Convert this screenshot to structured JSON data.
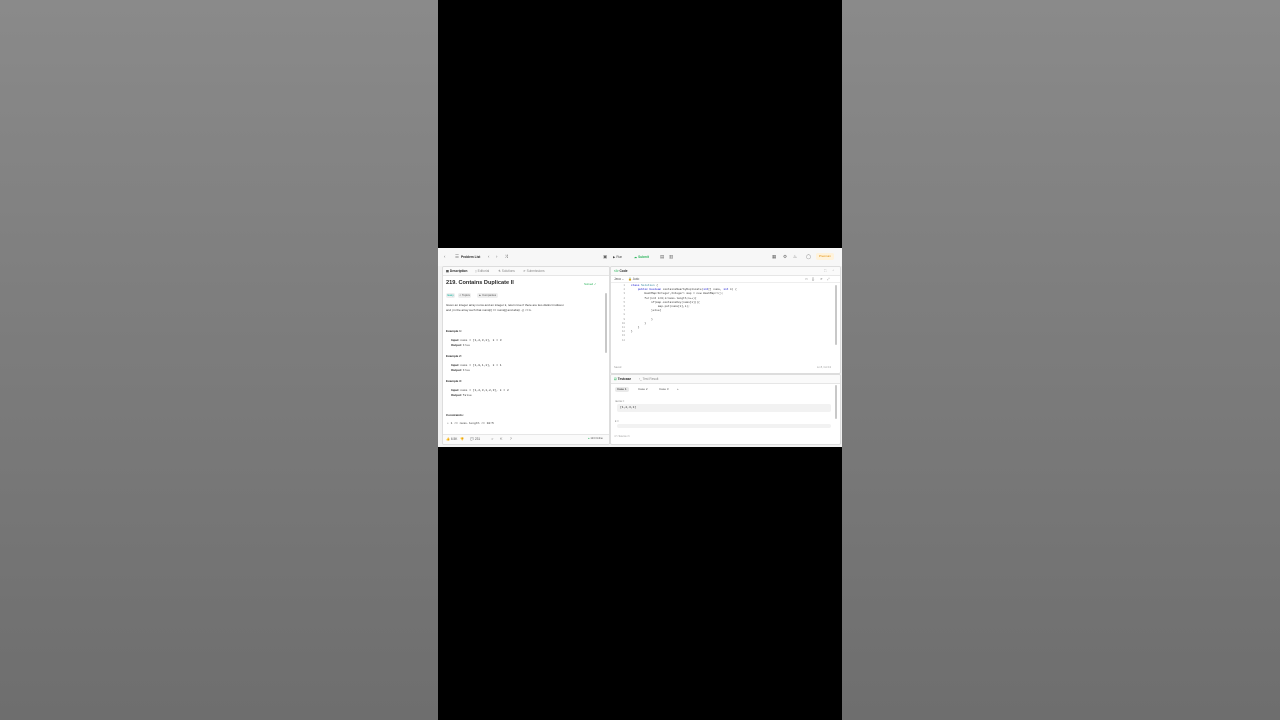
{
  "app": {
    "problem_list_label": "Problem List",
    "run_label": "Run",
    "submit_label": "Submit",
    "premium_label": "Premium"
  },
  "left": {
    "tabs": [
      "Description",
      "Editorial",
      "Solutions",
      "Submissions"
    ],
    "title": "219. Contains Duplicate II",
    "solved": "Solved",
    "chips": [
      "Easy",
      "Topics",
      "Companies"
    ],
    "desc_line1": "Given an integer array nums and an integer k, return true if there are two distinct indices i",
    "desc_line2": "and j in the array such that nums[i] == nums[j] and abs(i - j) <= k.",
    "examples": [
      {
        "heading": "Example 1:",
        "input": "nums = [1,2,3,1], k = 3",
        "output": "true"
      },
      {
        "heading": "Example 2:",
        "input": "nums = [1,0,1,1], k = 1",
        "output": "true"
      },
      {
        "heading": "Example 3:",
        "input": "nums = [1,2,3,1,2,3], k = 2",
        "output": "false"
      }
    ],
    "input_label": "Input:",
    "output_label": "Output:",
    "constraints_label": "Constraints:",
    "constraint1": "1 <= nums.length <= 10^5",
    "footer": {
      "likes": "6.5K",
      "comments": "231",
      "online": "123 Online"
    }
  },
  "code": {
    "tab": "Code",
    "language": "Java",
    "auto_label": "Auto",
    "lines": [
      "class Solution {",
      "    public boolean containsNearbyDuplicate(int[] nums, int k) {",
      "        HashMap<Integer,Integer> map = new HashMap<>();",
      "        for(int i=0;i<nums.length;i++){",
      "            if(map.containsKey(nums[i])){",
      "                map.put(nums[i],i);",
      "            }else{",
      "",
      "            }",
      "        }",
      "    }",
      "}",
      "",
      ""
    ],
    "saved": "Saved",
    "cursor": "Ln 8, Col 13"
  },
  "test": {
    "tabs": [
      "Testcase",
      "Test Result"
    ],
    "cases": [
      "Case 1",
      "Case 2",
      "Case 3"
    ],
    "add": "+",
    "nums_label": "nums =",
    "nums_value": "[1,2,3,1]",
    "k_label": "k =",
    "source": "Source"
  }
}
